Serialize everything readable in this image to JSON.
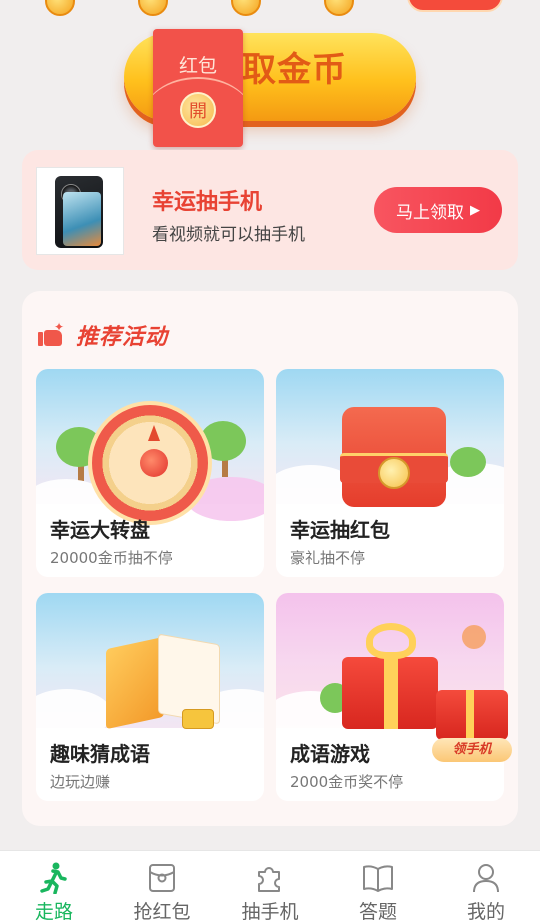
{
  "claim_button": {
    "label": "取金币",
    "visible_text": "取金币"
  },
  "red_envelope": {
    "label": "红包",
    "open_seal": "開"
  },
  "promo": {
    "title": "幸运抽手机",
    "subtitle": "看视频就可以抽手机",
    "button_label": "马上领取",
    "button_arrow": "▶"
  },
  "recommended": {
    "title": "推荐活动",
    "tiles": [
      {
        "title": "幸运大转盘",
        "subtitle": "20000金币抽不停"
      },
      {
        "title": "幸运抽红包",
        "subtitle": "豪礼抽不停"
      },
      {
        "title": "趣味猜成语",
        "subtitle": "边玩边赚"
      },
      {
        "title": "成语游戏",
        "subtitle": "2000金币奖不停",
        "badge": "领手机"
      }
    ]
  },
  "tabbar": {
    "active_color": "#19b65e",
    "inactive_color": "#666666",
    "items": [
      {
        "label": "走路",
        "icon": "walking-person-icon",
        "active": true
      },
      {
        "label": "抢红包",
        "icon": "red-packet-icon",
        "active": false
      },
      {
        "label": "抽手机",
        "icon": "puzzle-icon",
        "active": false
      },
      {
        "label": "答题",
        "icon": "book-icon",
        "active": false
      },
      {
        "label": "我的",
        "icon": "user-icon",
        "active": false
      }
    ]
  }
}
